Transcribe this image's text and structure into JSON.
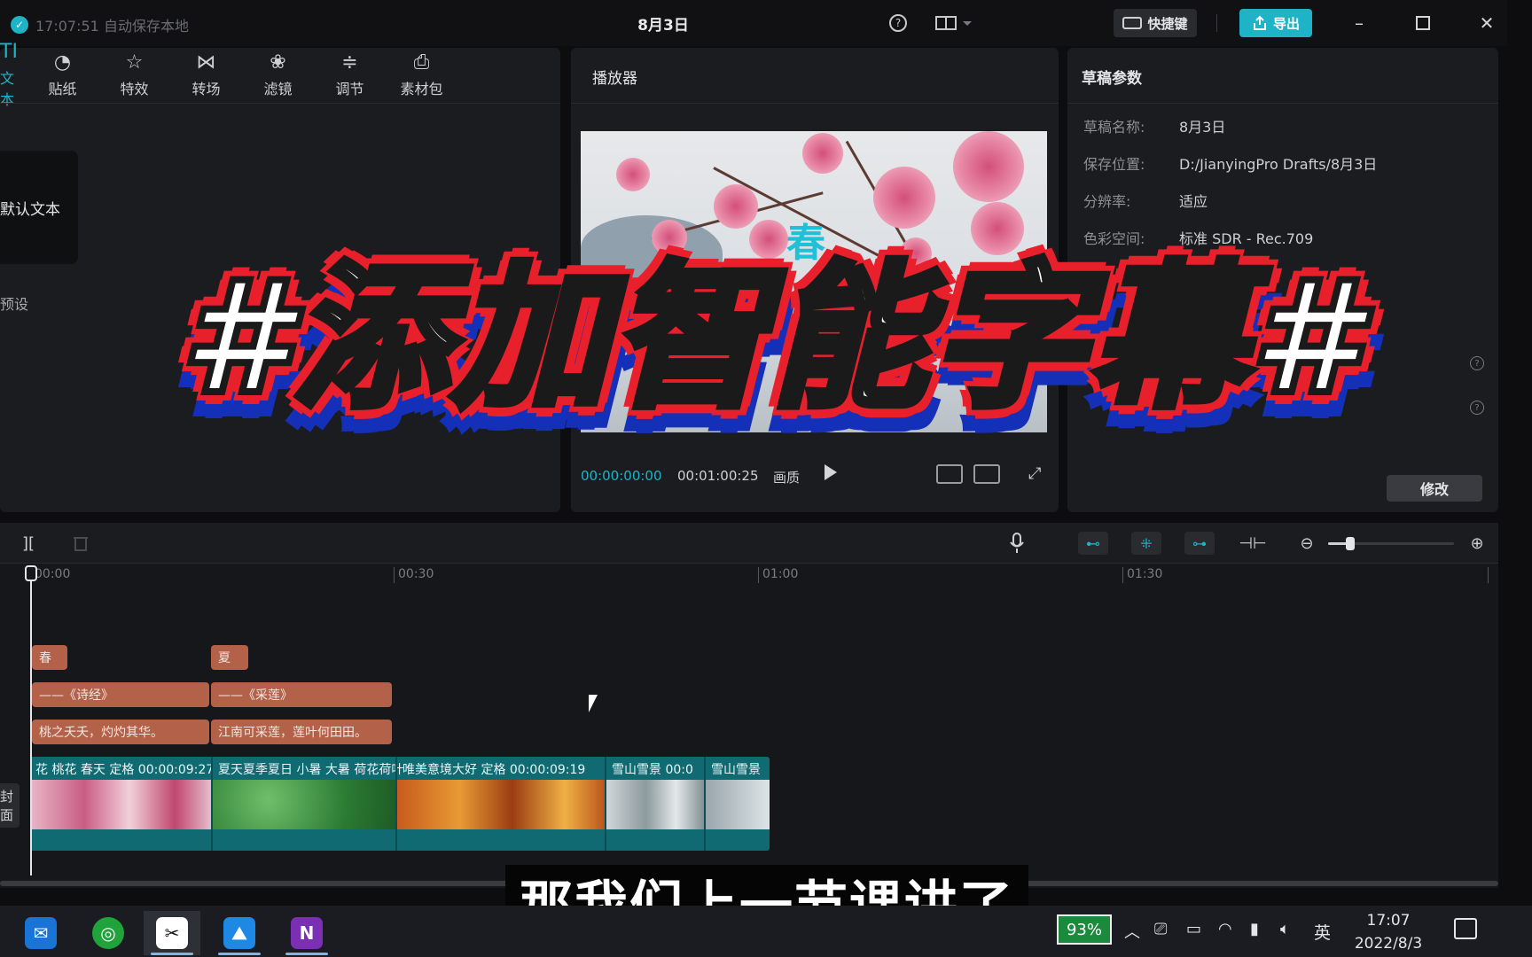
{
  "titlebar": {
    "save_status": "17:07:51 自动保存本地",
    "doc_title": "8月3日",
    "shortcut_label": "快捷键",
    "export_label": "导出",
    "icons": [
      "help-icon",
      "layout-icon",
      "keyboard-icon",
      "export-icon",
      "minimize-icon",
      "maximize-icon",
      "close-icon"
    ]
  },
  "left_panel": {
    "tabs": [
      {
        "label": "文本",
        "icon": "text-icon",
        "glyph": "TI"
      },
      {
        "label": "贴纸",
        "icon": "sticker-icon",
        "glyph": "◔"
      },
      {
        "label": "特效",
        "icon": "effects-icon",
        "glyph": "☆"
      },
      {
        "label": "转场",
        "icon": "transition-icon",
        "glyph": "⋈"
      },
      {
        "label": "滤镜",
        "icon": "filter-icon",
        "glyph": "❀"
      },
      {
        "label": "调节",
        "icon": "adjust-icon",
        "glyph": "≑"
      },
      {
        "label": "素材包",
        "icon": "material-pack-icon",
        "glyph": "⎙"
      }
    ],
    "default_text_card": "默认文本",
    "preset_label": "预设"
  },
  "player": {
    "title": "播放器",
    "current_time": "00:00:00:00",
    "total_time": "00:01:00:25",
    "ratio_label": "画质"
  },
  "draft": {
    "title": "草稿参数",
    "params": [
      {
        "key": "草稿名称:",
        "value": "8月3日"
      },
      {
        "key": "保存位置:",
        "value": "D:/JianyingPro Drafts/8月3日"
      },
      {
        "key": "分辨率:",
        "value": "适应"
      },
      {
        "key": "色彩空间:",
        "value": "标准 SDR - Rec.709"
      }
    ],
    "edit_label": "修改"
  },
  "timeline": {
    "ruler": [
      "00:00",
      "00:30",
      "01:00",
      "01:30"
    ],
    "text_clips_row1": [
      "春",
      "夏"
    ],
    "text_clips_row2": [
      "——《诗经》",
      "——《采莲》"
    ],
    "text_clips_row3": [
      "桃之夭夭，灼灼其华。",
      "江南可采莲，莲叶何田田。"
    ],
    "video_clips": [
      {
        "label": "花 桃花 春天   定格   00:00:09:27"
      },
      {
        "label": "夏天夏季夏日 小暑 大暑 荷花荷叶"
      },
      {
        "label": "唯美意境大好   定格   00:00:09:19"
      },
      {
        "label": "雪山雪景   00:0"
      },
      {
        "label": "雪山雪景"
      }
    ],
    "side_label": "封面"
  },
  "overlay": {
    "headline": "#添加智能字幕#",
    "subtitle": "那我们上一节课讲了"
  },
  "taskbar": {
    "apps": [
      "mail-app-icon",
      "wechat-app-icon",
      "capcut-app-icon",
      "photos-app-icon",
      "onenote-app-icon"
    ],
    "battery": "93%",
    "ime": "英",
    "time": "17:07",
    "date": "2022/8/3"
  },
  "colors": {
    "accent": "#1fb3c7",
    "clip_text": "#b4614a",
    "video_track": "#0f6a72",
    "headline_fill": "#ffffff",
    "headline_outline": "#e8202c",
    "headline_shadow": "#1530b8"
  }
}
